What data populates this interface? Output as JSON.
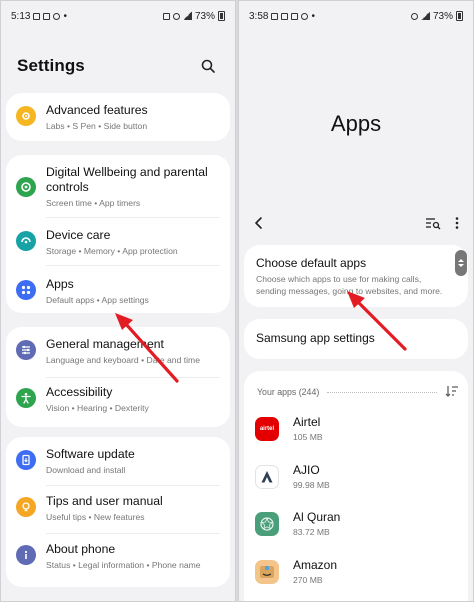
{
  "colors": {
    "background": "#f2f2f5",
    "card": "#ffffff",
    "arrow": "#e31b23",
    "advanced_features_icon": "#f5b622",
    "digital_wellbeing_icon": "#2ea44f",
    "device_care_icon": "#17a3a6",
    "apps_icon": "#3d6df2",
    "general_management_icon": "#5f6bb5",
    "accessibility_icon": "#2ea44f",
    "software_update_icon": "#3d6df2",
    "tips_icon": "#f5a623",
    "about_phone_icon": "#5f6bb5",
    "airtel": "#e40000",
    "ajio": "#2c3e50",
    "al_quran": "#4b9e7a",
    "amazon": "#f4c58a"
  },
  "left": {
    "status": {
      "time": "5:13",
      "battery": "73%"
    },
    "header": {
      "title": "Settings",
      "search_icon": "search-icon"
    },
    "items": [
      {
        "title": "Advanced features",
        "subtitle": "Labs  •  S Pen  •  Side button",
        "icon": "gear-plus-icon"
      },
      {
        "title": "Digital Wellbeing and parental controls",
        "subtitle": "Screen time  •  App timers",
        "icon": "wellbeing-icon"
      },
      {
        "title": "Device care",
        "subtitle": "Storage  •  Memory  •  App protection",
        "icon": "device-care-icon"
      },
      {
        "title": "Apps",
        "subtitle": "Default apps  •  App settings",
        "icon": "apps-grid-icon"
      },
      {
        "title": "General management",
        "subtitle": "Language and keyboard  •  Date and time",
        "icon": "sliders-icon"
      },
      {
        "title": "Accessibility",
        "subtitle": "Vision  •  Hearing  •  Dexterity",
        "icon": "accessibility-icon"
      },
      {
        "title": "Software update",
        "subtitle": "Download and install",
        "icon": "update-icon"
      },
      {
        "title": "Tips and user manual",
        "subtitle": "Useful tips  •  New features",
        "icon": "bulb-icon"
      },
      {
        "title": "About phone",
        "subtitle": "Status  •  Legal information  •  Phone name",
        "icon": "info-icon"
      }
    ]
  },
  "right": {
    "status": {
      "time": "3:58",
      "battery": "73%"
    },
    "title": "Apps",
    "default_apps": {
      "title": "Choose default apps",
      "subtitle": "Choose which apps to use for making calls, sending messages, going to websites, and more."
    },
    "samsung_settings": {
      "title": "Samsung app settings"
    },
    "list_header": "Your apps (244)",
    "apps": [
      {
        "name": "Airtel",
        "size": "105 MB",
        "icon_label": "airtel"
      },
      {
        "name": "AJIO",
        "size": "99.98 MB",
        "icon_label": ""
      },
      {
        "name": "Al Quran",
        "size": "83.72 MB",
        "icon_label": ""
      },
      {
        "name": "Amazon",
        "size": "270 MB",
        "icon_label": ""
      }
    ]
  }
}
